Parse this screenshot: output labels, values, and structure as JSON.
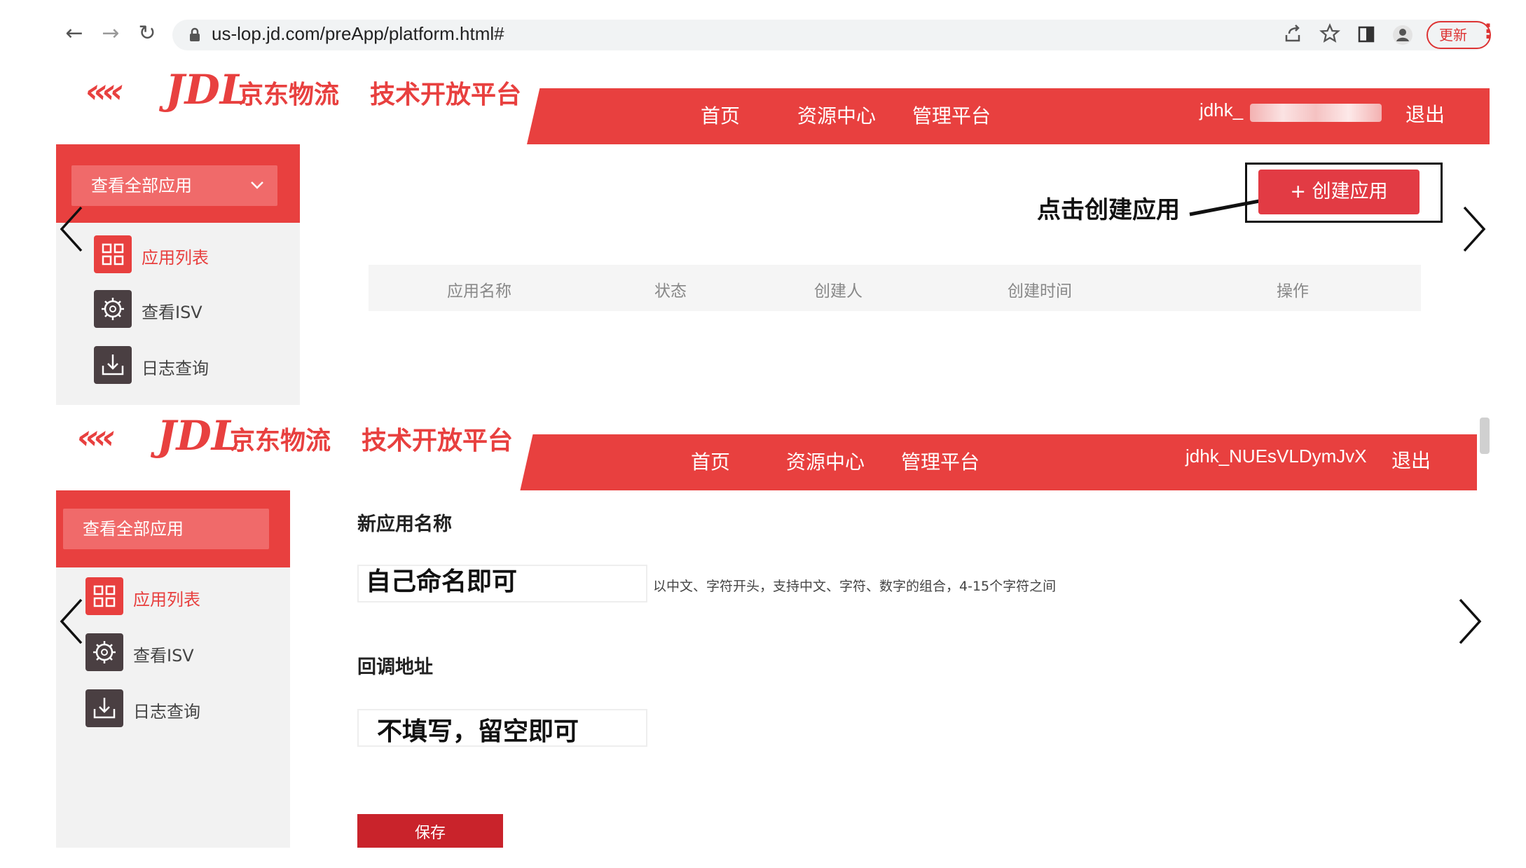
{
  "browser": {
    "url": "us-lop.jd.com/preApp/platform.html#",
    "update_label": "更新"
  },
  "brand": {
    "logo_chevrons": "‹‹‹‹",
    "logo_jdl": "JDL",
    "logo_cn": "京东物流",
    "platform_name": "技术开放平台"
  },
  "nav": {
    "home": "首页",
    "resources": "资源中心",
    "manage": "管理平台",
    "logout": "退出"
  },
  "panel1": {
    "username": "jdhk_",
    "select_all": "查看全部应用",
    "sidebar": [
      "应用列表",
      "查看ISV",
      "日志查询"
    ],
    "annotation": "点击创建应用",
    "create_button": "+ 创建应用",
    "table_headers": [
      "应用名称",
      "状态",
      "创建人",
      "创建时间",
      "操作"
    ]
  },
  "panel2": {
    "username": "jdhk_NUEsVLDymJvX",
    "select_all": "查看全部应用",
    "sidebar": [
      "应用列表",
      "查看ISV",
      "日志查询"
    ],
    "name_label": "新应用名称",
    "name_value": "自己命名即可",
    "name_hint": "以中文、字符开头，支持中文、字符、数字的组合，4-15个字符之间",
    "callback_label": "回调地址",
    "callback_value": "不填写，留空即可",
    "save_button": "保存"
  },
  "colors": {
    "brand_red": "#e8403f",
    "button_red": "#e23b44",
    "sidebar_bg": "#f2f2f2"
  }
}
